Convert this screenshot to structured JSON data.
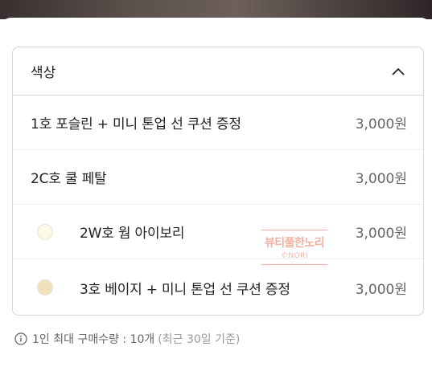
{
  "dropdown": {
    "title": "색상",
    "options": [
      {
        "label": "1호 포슬린 + 미니 톤업 선 쿠션 증정",
        "price": "3,000원",
        "swatch": null
      },
      {
        "label": "2C호 쿨 페탈",
        "price": "3,000원",
        "swatch": null
      },
      {
        "label": "2W호 웜 아이보리",
        "price": "3,000원",
        "swatch": "#fdf8e6"
      },
      {
        "label": "3호 베이지 + 미니 톤업 선 쿠션 증정",
        "price": "3,000원",
        "swatch": "#f3e0bd"
      }
    ]
  },
  "watermark": {
    "main": "뷰티풀한노리",
    "sub": "©NORI"
  },
  "notice": {
    "text": "1인 최대 구매수량 : 10개",
    "sub": "(최근 30일 기준)"
  },
  "icons": {
    "collapse": "chevron-up-icon",
    "info": "info-circle-icon"
  }
}
